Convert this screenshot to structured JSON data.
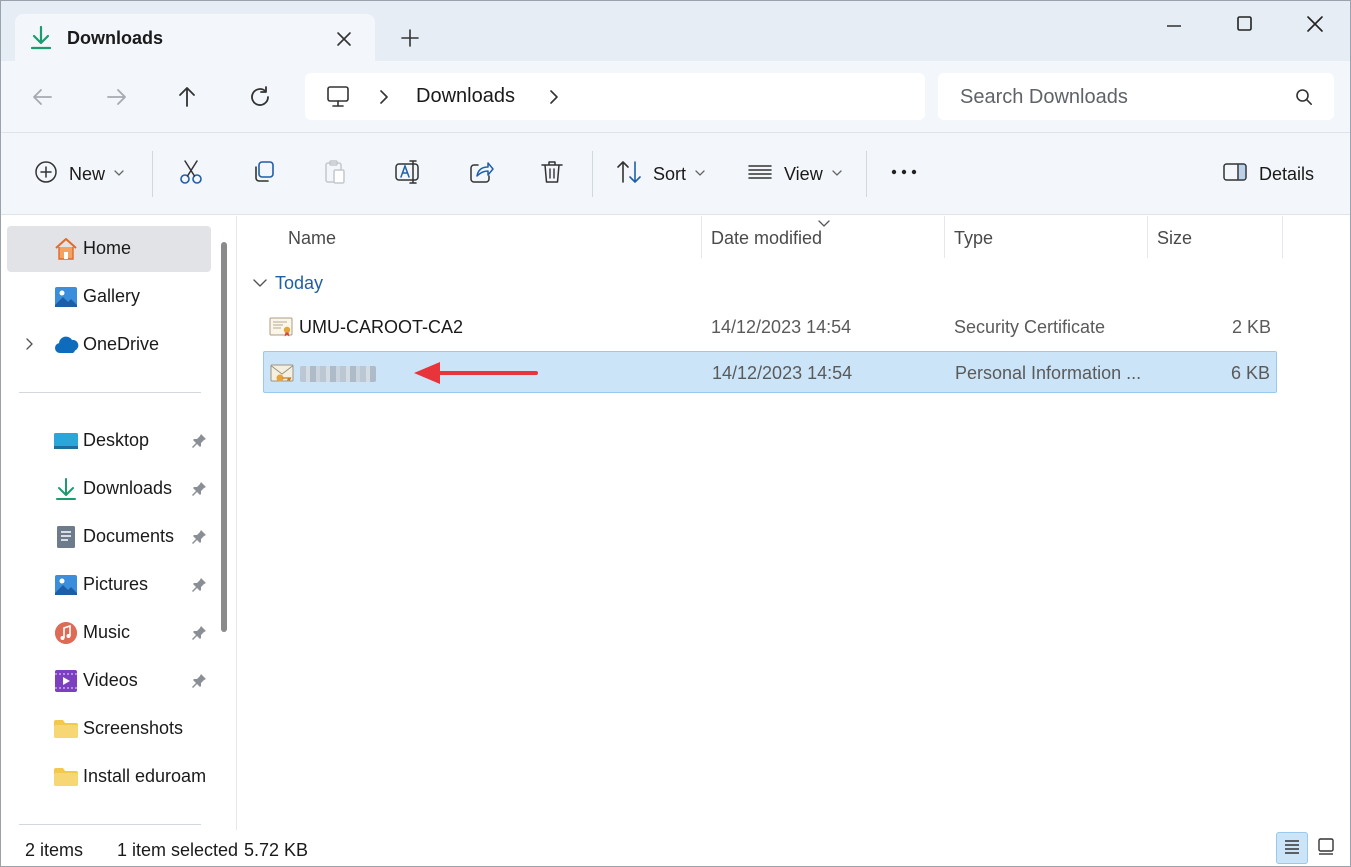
{
  "tab": {
    "title": "Downloads",
    "close_icon": "close-icon",
    "new_tab_icon": "plus-icon"
  },
  "window_controls": [
    "minimize-icon",
    "maximize-icon",
    "close-icon"
  ],
  "address": {
    "root_icon": "computer-icon",
    "crumbs": [
      "Downloads"
    ]
  },
  "search": {
    "placeholder": "Search Downloads"
  },
  "toolbar": {
    "new_label": "New",
    "sort_label": "Sort",
    "view_label": "View",
    "details_label": "Details",
    "icons": [
      "cut-icon",
      "copy-icon",
      "paste-icon",
      "rename-icon",
      "share-icon",
      "delete-icon",
      "more-icon"
    ]
  },
  "sidebar": {
    "items": [
      {
        "label": "Home",
        "icon": "home-icon",
        "selected": true
      },
      {
        "label": "Gallery",
        "icon": "gallery-icon"
      },
      {
        "label": "OneDrive",
        "icon": "cloud-icon",
        "expandable": true
      },
      {
        "label": "Desktop",
        "icon": "desktop-icon",
        "pinned": true
      },
      {
        "label": "Downloads",
        "icon": "download-icon",
        "pinned": true
      },
      {
        "label": "Documents",
        "icon": "documents-icon",
        "pinned": true
      },
      {
        "label": "Pictures",
        "icon": "pictures-icon",
        "pinned": true
      },
      {
        "label": "Music",
        "icon": "music-icon",
        "pinned": true
      },
      {
        "label": "Videos",
        "icon": "videos-icon",
        "pinned": true
      },
      {
        "label": "Screenshots",
        "icon": "folder-icon"
      },
      {
        "label": "Install eduroam",
        "icon": "folder-icon"
      }
    ]
  },
  "columns": {
    "name": "Name",
    "date": "Date modified",
    "type": "Type",
    "size": "Size"
  },
  "group": {
    "label": "Today"
  },
  "files": [
    {
      "name": "UMU-CAROOT-CA2",
      "date": "14/12/2023 14:54",
      "type": "Security Certificate",
      "size": "2 KB",
      "icon": "certificate-icon",
      "selected": false
    },
    {
      "name": "",
      "date": "14/12/2023 14:54",
      "type": "Personal Information ...",
      "size": "6 KB",
      "icon": "personal-info-icon",
      "selected": true
    }
  ],
  "status": {
    "items": "2 items",
    "selected": "1 item selected",
    "selected_size": "5.72 KB"
  },
  "colors": {
    "accent": "#1f5fa8",
    "selection": "#cce4f7",
    "arrow": "#e8343b",
    "chrome": "#f3f6fa"
  }
}
